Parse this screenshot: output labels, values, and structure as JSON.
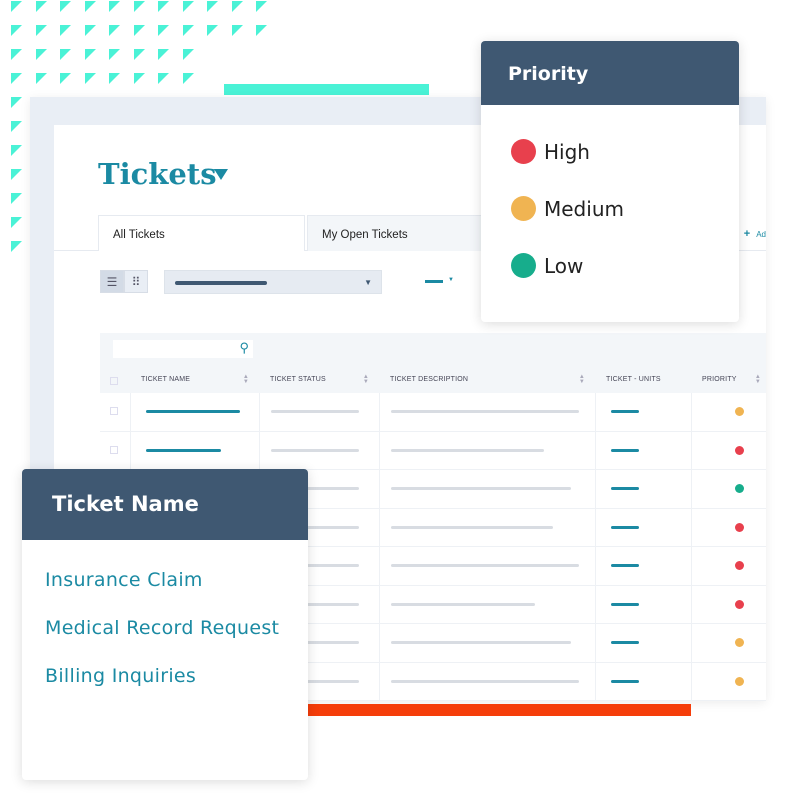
{
  "colors": {
    "accent": "#1b8aa3",
    "header": "#3f5872",
    "high": "#e8404d",
    "medium": "#f0b452",
    "low": "#17ad8c",
    "decor_teal": "#4af2d6",
    "decor_orange": "#f53d0a"
  },
  "page": {
    "title": "Tickets",
    "title_icon": "caret-down-icon"
  },
  "tabs": [
    {
      "label": "All Tickets"
    },
    {
      "label": "My Open Tickets"
    }
  ],
  "add_label": "Ad",
  "table": {
    "columns": [
      "TICKET NAME",
      "TICKET STATUS",
      "TICKET DESCRIPTION",
      "TICKET - UNITS",
      "PRIORITY"
    ],
    "row_priorities": [
      "medium",
      "high",
      "low",
      "high",
      "high",
      "high",
      "medium",
      "medium"
    ]
  },
  "priority_card": {
    "title": "Priority",
    "items": [
      {
        "label": "High",
        "level": "high"
      },
      {
        "label": "Medium",
        "level": "medium"
      },
      {
        "label": "Low",
        "level": "low"
      }
    ]
  },
  "ticket_name_card": {
    "title": "Ticket Name",
    "items": [
      "Insurance Claim",
      "Medical Record Request",
      "Billing Inquiries"
    ]
  }
}
